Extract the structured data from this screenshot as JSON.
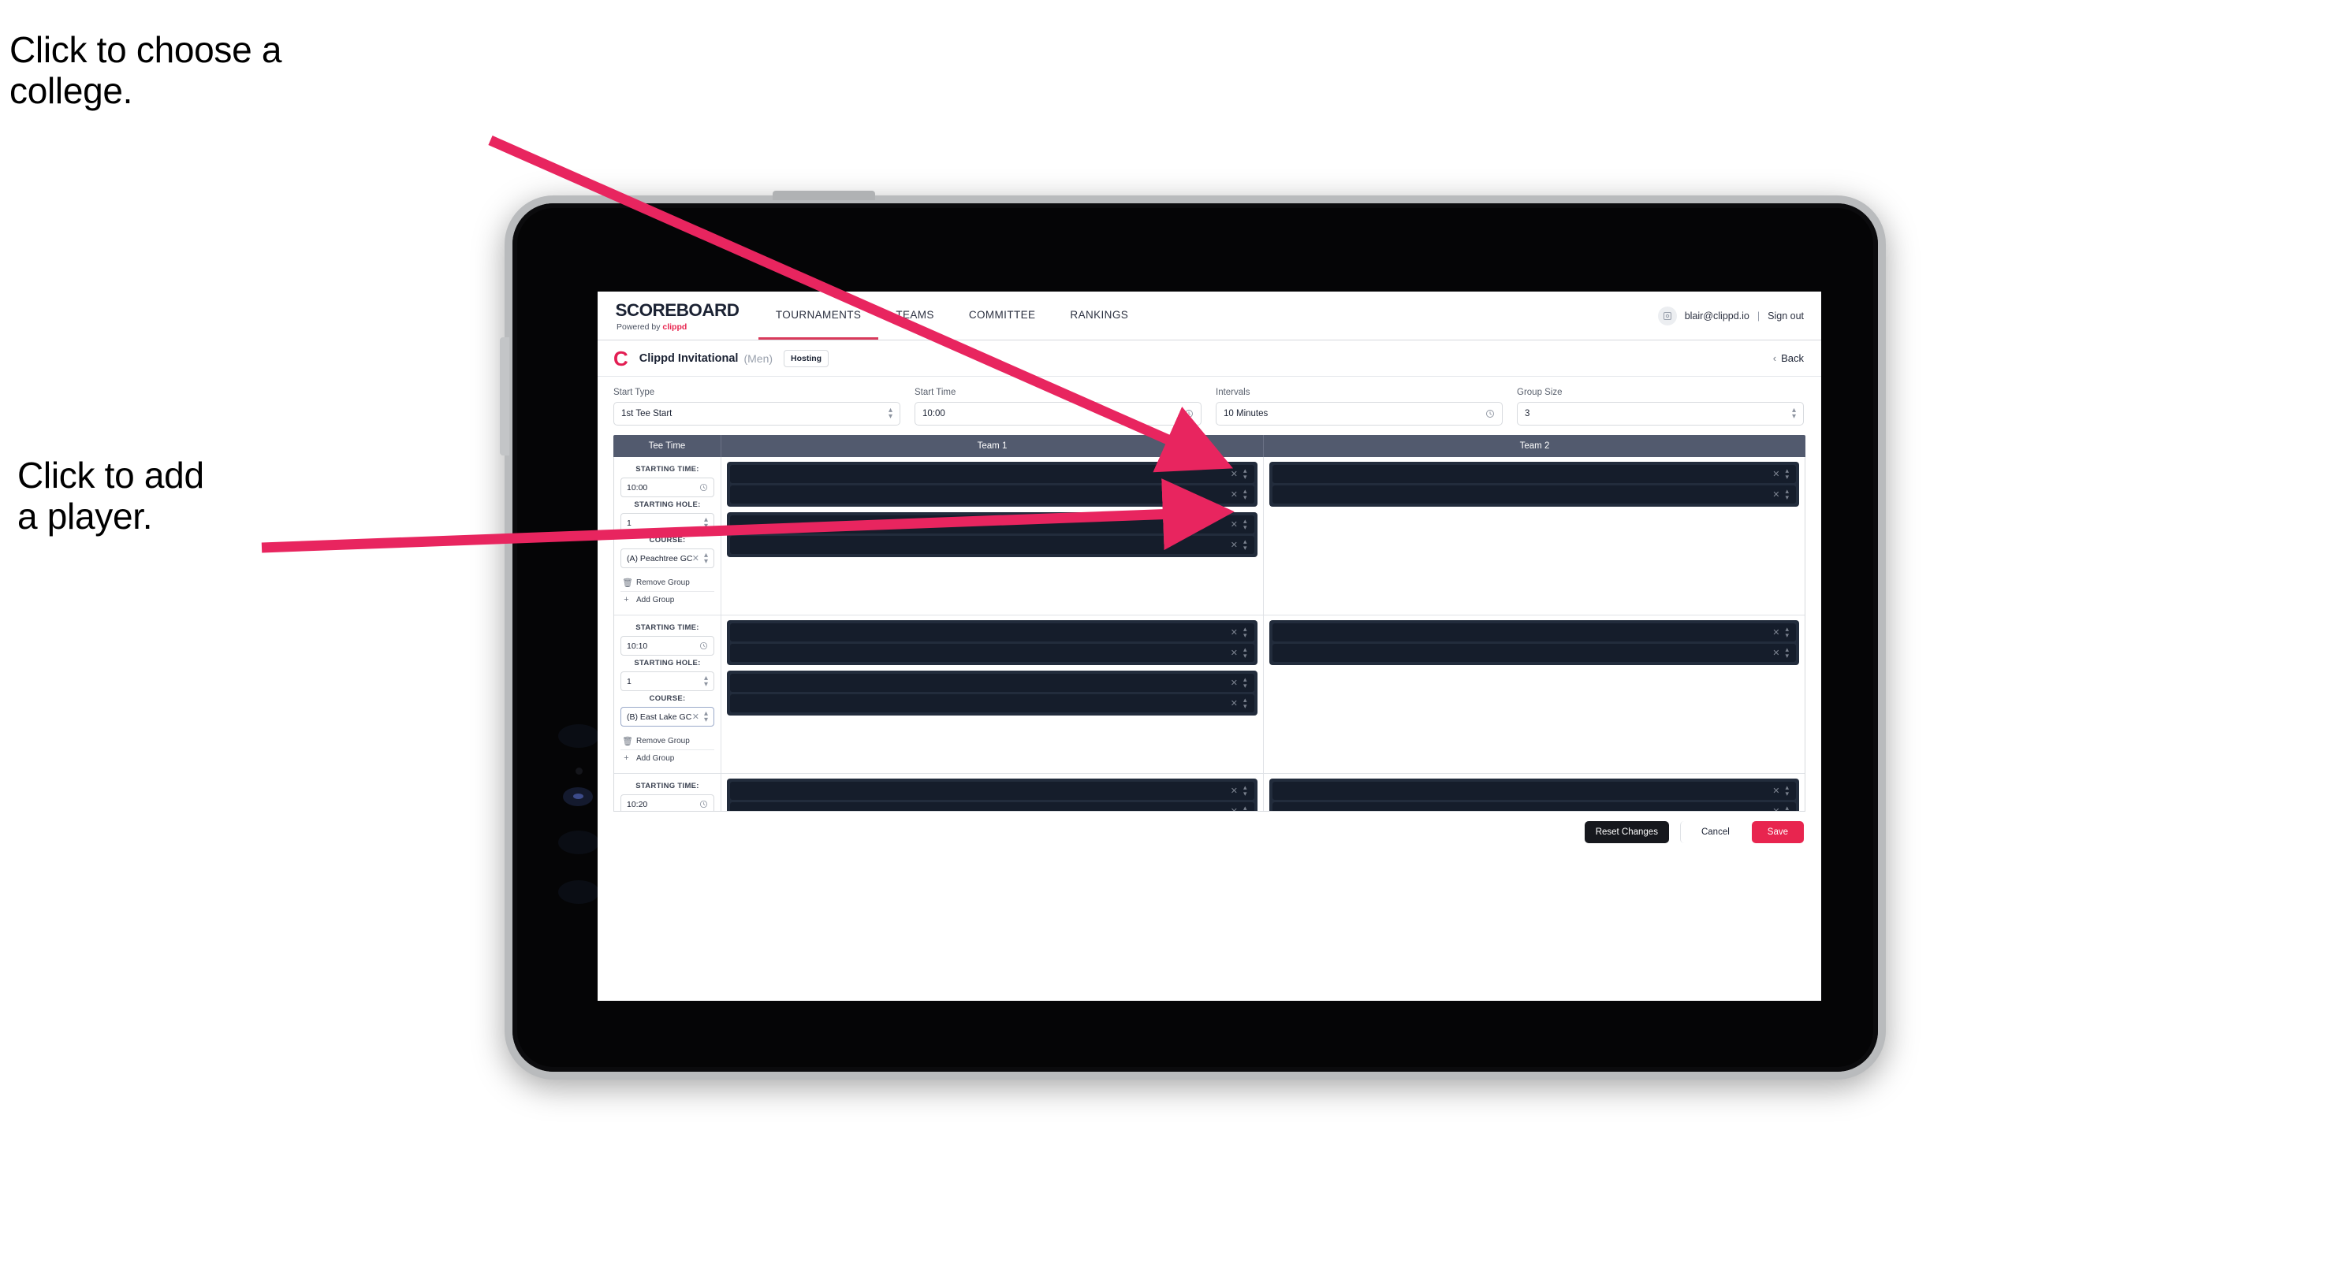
{
  "annotations": [
    {
      "id": "college",
      "text": "Click to choose a\ncollege."
    },
    {
      "id": "player",
      "text": "Click to add\na player."
    }
  ],
  "colors": {
    "accent_pink": "#e8254f",
    "nav_underline": "#d93a5c",
    "table_header": "#525a6e",
    "player_card": "#222c3c",
    "player_row": "#151d2b",
    "annotation_arrow": "#e8255f"
  },
  "topnav": {
    "brand_word": "SCOREBOARD",
    "brand_sub_prefix": "Powered by",
    "brand_sub_name": "clippd",
    "tabs": [
      {
        "label": "TOURNAMENTS",
        "active": true
      },
      {
        "label": "TEAMS",
        "active": false
      },
      {
        "label": "COMMITTEE",
        "active": false
      },
      {
        "label": "RANKINGS",
        "active": false
      }
    ],
    "avatar_icon": "user-avatar-icon",
    "user_email": "blair@clippd.io",
    "separator": "|",
    "sign_out": "Sign out"
  },
  "tournament_header": {
    "logo_letter": "C",
    "title": "Clippd Invitational",
    "gender": "(Men)",
    "status_badge": "Hosting",
    "back_chevron": "‹",
    "back_label": "Back"
  },
  "filters": [
    {
      "label": "Start Type",
      "value": "1st Tee Start",
      "icon": "stepper-icon"
    },
    {
      "label": "Start Time",
      "value": "10:00",
      "icon": "clock-icon"
    },
    {
      "label": "Intervals",
      "value": "10 Minutes",
      "icon": "clock-icon"
    },
    {
      "label": "Group Size",
      "value": "3",
      "icon": "stepper-icon"
    }
  ],
  "table": {
    "headers": [
      "Tee Time",
      "Team 1",
      "Team 2"
    ],
    "field_labels": {
      "starting_time": "STARTING TIME:",
      "starting_hole": "STARTING HOLE:",
      "course": "COURSE:"
    },
    "group_actions": {
      "remove": "Remove Group",
      "remove_icon": "trash-icon",
      "add": "Add Group",
      "add_icon": "plus-icon"
    },
    "clear_icon": "x-icon",
    "stepper_icon": "stepper-icon",
    "clock_icon": "clock-icon",
    "groups": [
      {
        "starting_time": "10:00",
        "starting_hole": "1",
        "course": "(A) Peachtree GC",
        "course_focused": false,
        "team1_cards": [
          {
            "rows": 2
          },
          {
            "rows": 2
          }
        ],
        "team2_cards": [
          {
            "rows": 2
          }
        ]
      },
      {
        "starting_time": "10:10",
        "starting_hole": "1",
        "course": "(B) East Lake GC",
        "course_focused": true,
        "team1_cards": [
          {
            "rows": 2
          },
          {
            "rows": 2
          }
        ],
        "team2_cards": [
          {
            "rows": 2
          }
        ]
      },
      {
        "starting_time": "10:20",
        "starting_hole": "",
        "course": "",
        "course_focused": false,
        "team1_cards": [
          {
            "rows": 2
          }
        ],
        "team2_cards": [
          {
            "rows": 2
          }
        ]
      }
    ]
  },
  "footer": {
    "reset": "Reset Changes",
    "cancel": "Cancel",
    "save": "Save"
  }
}
